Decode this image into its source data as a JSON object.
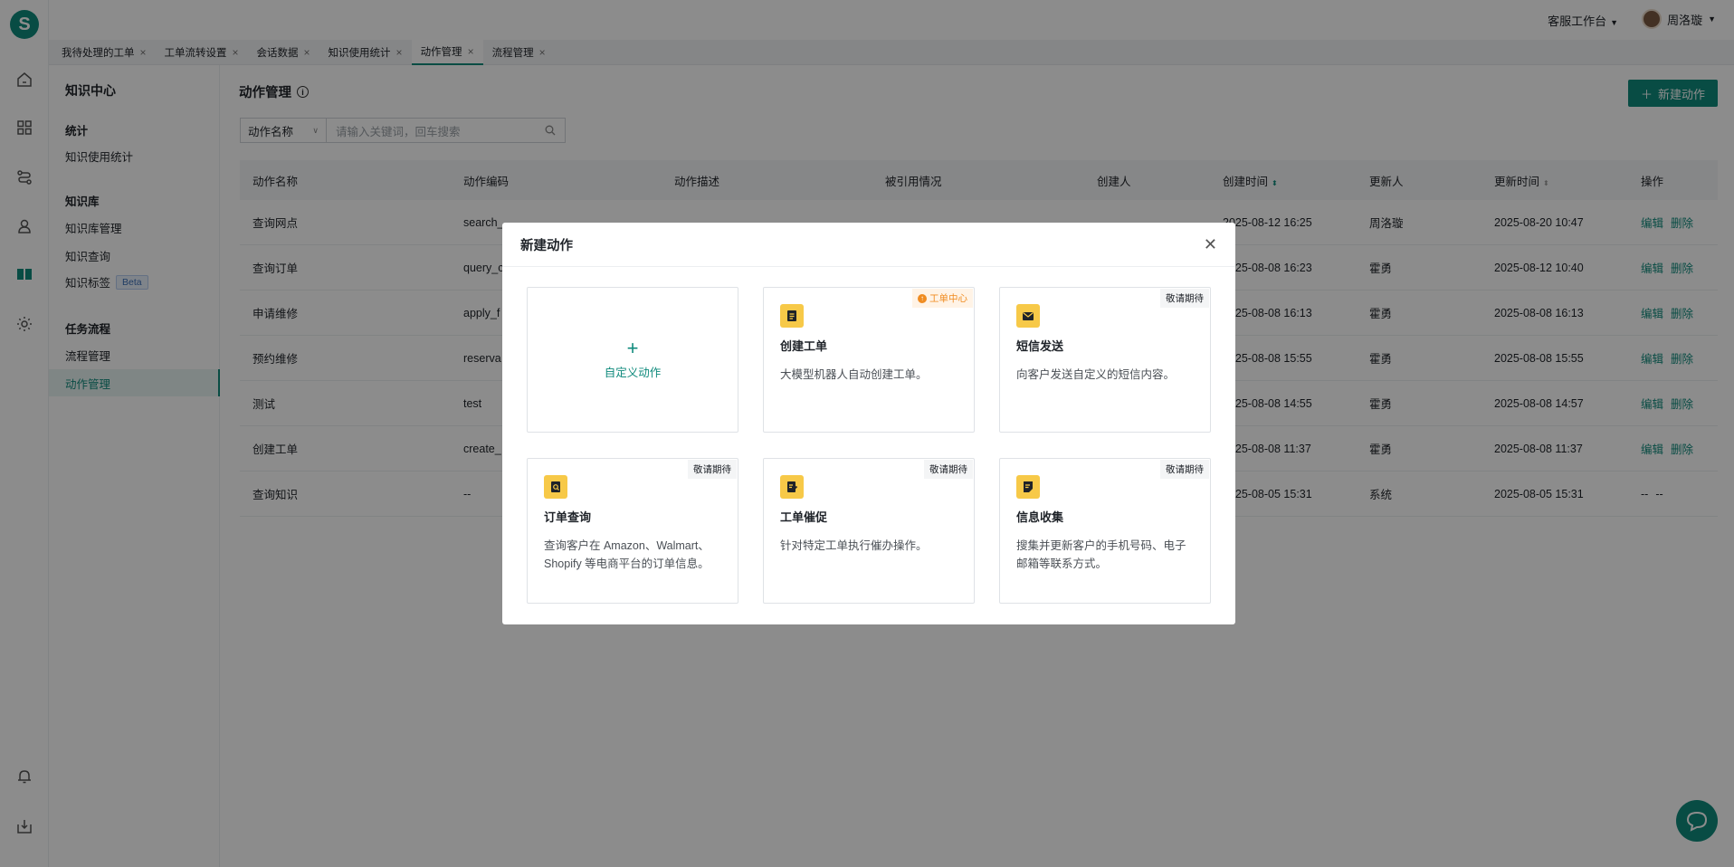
{
  "app": {
    "logo_letter": "S",
    "workspace": "客服工作台",
    "user_name": "周洛璇"
  },
  "tabs": [
    {
      "label": "我待处理的工单"
    },
    {
      "label": "工单流转设置"
    },
    {
      "label": "会话数据"
    },
    {
      "label": "知识使用统计"
    },
    {
      "label": "动作管理"
    },
    {
      "label": "流程管理"
    }
  ],
  "sidebar": {
    "title": "知识中心",
    "group_stats": "统计",
    "item_usage": "知识使用统计",
    "group_kb": "知识库",
    "item_kb_manage": "知识库管理",
    "item_kb_query": "知识查询",
    "item_kb_tags": "知识标签",
    "beta": "Beta",
    "group_flow": "任务流程",
    "item_flow": "流程管理",
    "item_action": "动作管理"
  },
  "main": {
    "title": "动作管理",
    "new_button": "新建动作",
    "filter_select": "动作名称",
    "search_placeholder": "请输入关键词，回车搜索",
    "columns": [
      "动作名称",
      "动作编码",
      "动作描述",
      "被引用情况",
      "创建人",
      "创建时间",
      "更新人",
      "更新时间",
      "操作"
    ],
    "rows": [
      {
        "name": "查询网点",
        "code": "search_",
        "created": "2025-08-12 16:25",
        "updater": "周洛璇",
        "updated": "2025-08-20 10:47",
        "op1": "编辑",
        "op2": "删除"
      },
      {
        "name": "查询订单",
        "code": "query_c",
        "created": "2025-08-08 16:23",
        "updater": "霍勇",
        "updated": "2025-08-12 10:40",
        "op1": "编辑",
        "op2": "删除"
      },
      {
        "name": "申请维修",
        "code": "apply_f",
        "created": "2025-08-08 16:13",
        "updater": "霍勇",
        "updated": "2025-08-08 16:13",
        "op1": "编辑",
        "op2": "删除"
      },
      {
        "name": "预约维修",
        "code": "reserva",
        "created": "2025-08-08 15:55",
        "updater": "霍勇",
        "updated": "2025-08-08 15:55",
        "op1": "编辑",
        "op2": "删除"
      },
      {
        "name": "测试",
        "code": "test",
        "created": "2025-08-08 14:55",
        "updater": "霍勇",
        "updated": "2025-08-08 14:57",
        "op1": "编辑",
        "op2": "删除"
      },
      {
        "name": "创建工单",
        "code": "create_",
        "created": "2025-08-08 11:37",
        "updater": "霍勇",
        "updated": "2025-08-08 11:37",
        "op1": "编辑",
        "op2": "删除"
      },
      {
        "name": "查询知识",
        "code": "--",
        "created": "2025-08-05 15:31",
        "updater": "系统",
        "updated": "2025-08-05 15:31",
        "op1": "--",
        "op2": "--"
      }
    ]
  },
  "modal": {
    "title": "新建动作",
    "custom_label": "自定义动作",
    "cards": [
      {
        "title": "创建工单",
        "desc": "大模型机器人自动创建工单。",
        "badge": "工单中心"
      },
      {
        "title": "短信发送",
        "desc": "向客户发送自定义的短信内容。",
        "badge": "敬请期待"
      },
      {
        "title": "订单查询",
        "desc": "查询客户在 Amazon、Walmart、Shopify 等电商平台的订单信息。",
        "badge": "敬请期待"
      },
      {
        "title": "工单催促",
        "desc": "针对特定工单执行催办操作。",
        "badge": "敬请期待"
      },
      {
        "title": "信息收集",
        "desc": "搜集并更新客户的手机号码、电子邮箱等联系方式。",
        "badge": "敬请期待"
      }
    ]
  },
  "colors": {
    "accent": "#0f8a7c",
    "badge_orange": "#f08c21",
    "icon_yellow": "#f7c948"
  }
}
